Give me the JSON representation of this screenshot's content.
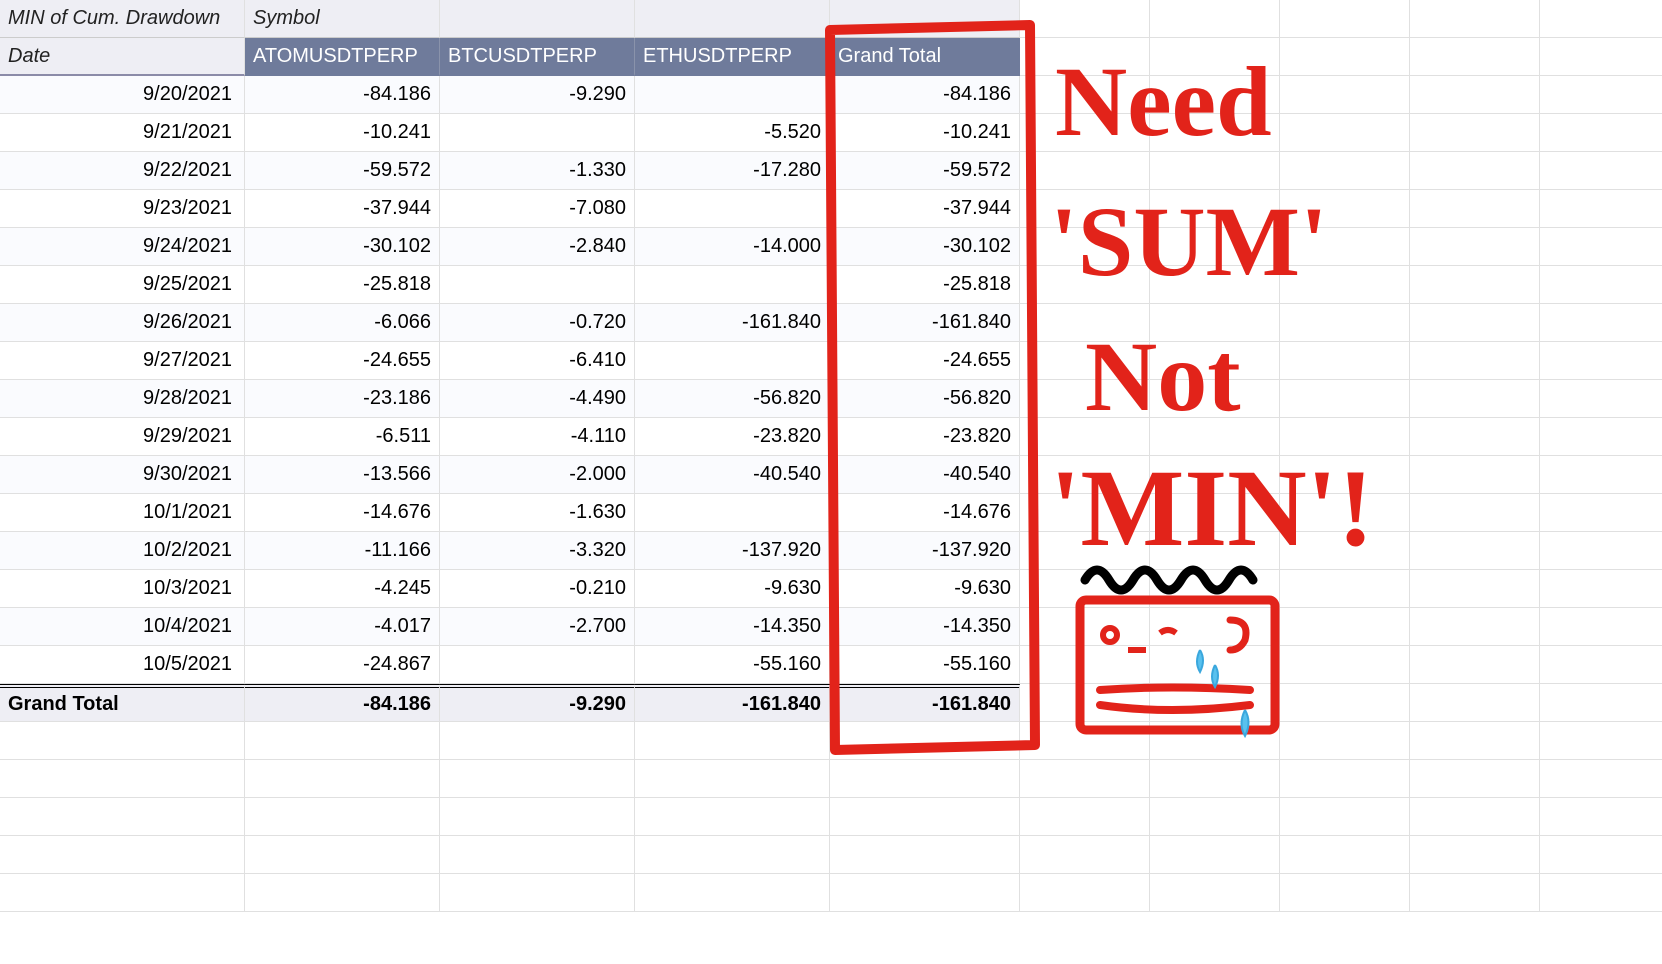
{
  "pivot": {
    "corner_label": "MIN of Cum. Drawdown",
    "col_field_label": "Symbol",
    "row_field_label": "Date",
    "columns": [
      "ATOMUSDTPERP",
      "BTCUSDTPERP",
      "ETHUSDTPERP",
      "Grand Total"
    ],
    "rows": [
      {
        "date": "9/20/2021",
        "vals": [
          "-84.186",
          "-9.290",
          "",
          "-84.186"
        ]
      },
      {
        "date": "9/21/2021",
        "vals": [
          "-10.241",
          "",
          "-5.520",
          "-10.241"
        ]
      },
      {
        "date": "9/22/2021",
        "vals": [
          "-59.572",
          "-1.330",
          "-17.280",
          "-59.572"
        ]
      },
      {
        "date": "9/23/2021",
        "vals": [
          "-37.944",
          "-7.080",
          "",
          "-37.944"
        ]
      },
      {
        "date": "9/24/2021",
        "vals": [
          "-30.102",
          "-2.840",
          "-14.000",
          "-30.102"
        ]
      },
      {
        "date": "9/25/2021",
        "vals": [
          "-25.818",
          "",
          "",
          "-25.818"
        ]
      },
      {
        "date": "9/26/2021",
        "vals": [
          "-6.066",
          "-0.720",
          "-161.840",
          "-161.840"
        ]
      },
      {
        "date": "9/27/2021",
        "vals": [
          "-24.655",
          "-6.410",
          "",
          "-24.655"
        ]
      },
      {
        "date": "9/28/2021",
        "vals": [
          "-23.186",
          "-4.490",
          "-56.820",
          "-56.820"
        ]
      },
      {
        "date": "9/29/2021",
        "vals": [
          "-6.511",
          "-4.110",
          "-23.820",
          "-23.820"
        ]
      },
      {
        "date": "9/30/2021",
        "vals": [
          "-13.566",
          "-2.000",
          "-40.540",
          "-40.540"
        ]
      },
      {
        "date": "10/1/2021",
        "vals": [
          "-14.676",
          "-1.630",
          "",
          "-14.676"
        ]
      },
      {
        "date": "10/2/2021",
        "vals": [
          "-11.166",
          "-3.320",
          "-137.920",
          "-137.920"
        ]
      },
      {
        "date": "10/3/2021",
        "vals": [
          "-4.245",
          "-0.210",
          "-9.630",
          "-9.630"
        ]
      },
      {
        "date": "10/4/2021",
        "vals": [
          "-4.017",
          "-2.700",
          "-14.350",
          "-14.350"
        ]
      },
      {
        "date": "10/5/2021",
        "vals": [
          "-24.867",
          "",
          "-55.160",
          "-55.160"
        ]
      }
    ],
    "grand_total_label": "Grand Total",
    "grand_total_vals": [
      "-84.186",
      "-9.290",
      "-161.840",
      "-161.840"
    ]
  },
  "annotation": {
    "text_lines": [
      "Need",
      "'SUM'",
      "Not",
      "'MIN'!"
    ],
    "color": "#e2231a"
  }
}
